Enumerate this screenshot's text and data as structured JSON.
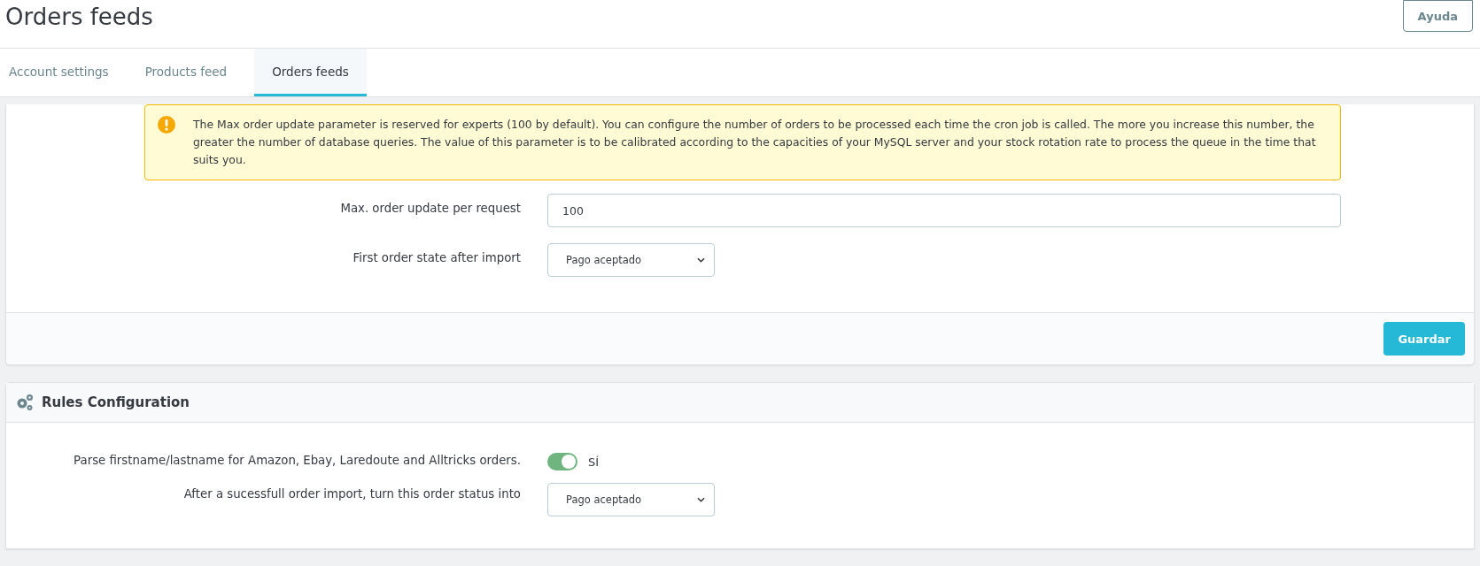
{
  "page": {
    "title": "Orders feeds",
    "help_button": "Ayuda"
  },
  "tabs": [
    {
      "label": "Account settings",
      "selected": false
    },
    {
      "label": "Products feed",
      "selected": false
    },
    {
      "label": "Orders feeds",
      "selected": true
    }
  ],
  "settings_panel": {
    "alert": "The Max order update parameter is reserved for experts (100 by default). You can configure the number of orders to be processed each time the cron job is called. The more you increase this number, the greater the number of database queries. The value of this parameter is to be calibrated according to the capacities of your MySQL server and your stock rotation rate to process the queue in the time that suits you.",
    "fields": [
      {
        "kind": "text",
        "label": "Max. order update per request",
        "value": "100"
      },
      {
        "kind": "select",
        "label": "First order state after import",
        "value": "Pago aceptado"
      }
    ],
    "save_button": "Guardar"
  },
  "rules_panel": {
    "title": "Rules Configuration",
    "fields": [
      {
        "kind": "toggle",
        "label": "Parse firstname/lastname for Amazon, Ebay, Laredoute and Alltricks orders.",
        "on": true,
        "value": "SÍ"
      },
      {
        "kind": "select",
        "label": "After a sucessfull order import, turn this order status into",
        "value": "Pago aceptado"
      }
    ]
  }
}
